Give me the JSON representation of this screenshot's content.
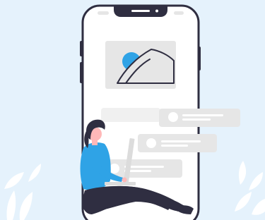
{
  "illustration": {
    "subject": "person-with-laptop-sitting-against-phone",
    "colors": {
      "background": "#e5f2fc",
      "phone_body": "#ffffff",
      "phone_outline": "#2f2e41",
      "card_fill": "#e6e6e6",
      "accent": "#2fa3e6",
      "hair": "#2f2e41",
      "pants": "#2f2e41",
      "laptop": "#dcdcdc",
      "plant": "#ffffff"
    },
    "icons": {
      "image_placeholder": "image-icon",
      "avatar": "avatar-icon",
      "leaf": "leaf-icon"
    }
  }
}
